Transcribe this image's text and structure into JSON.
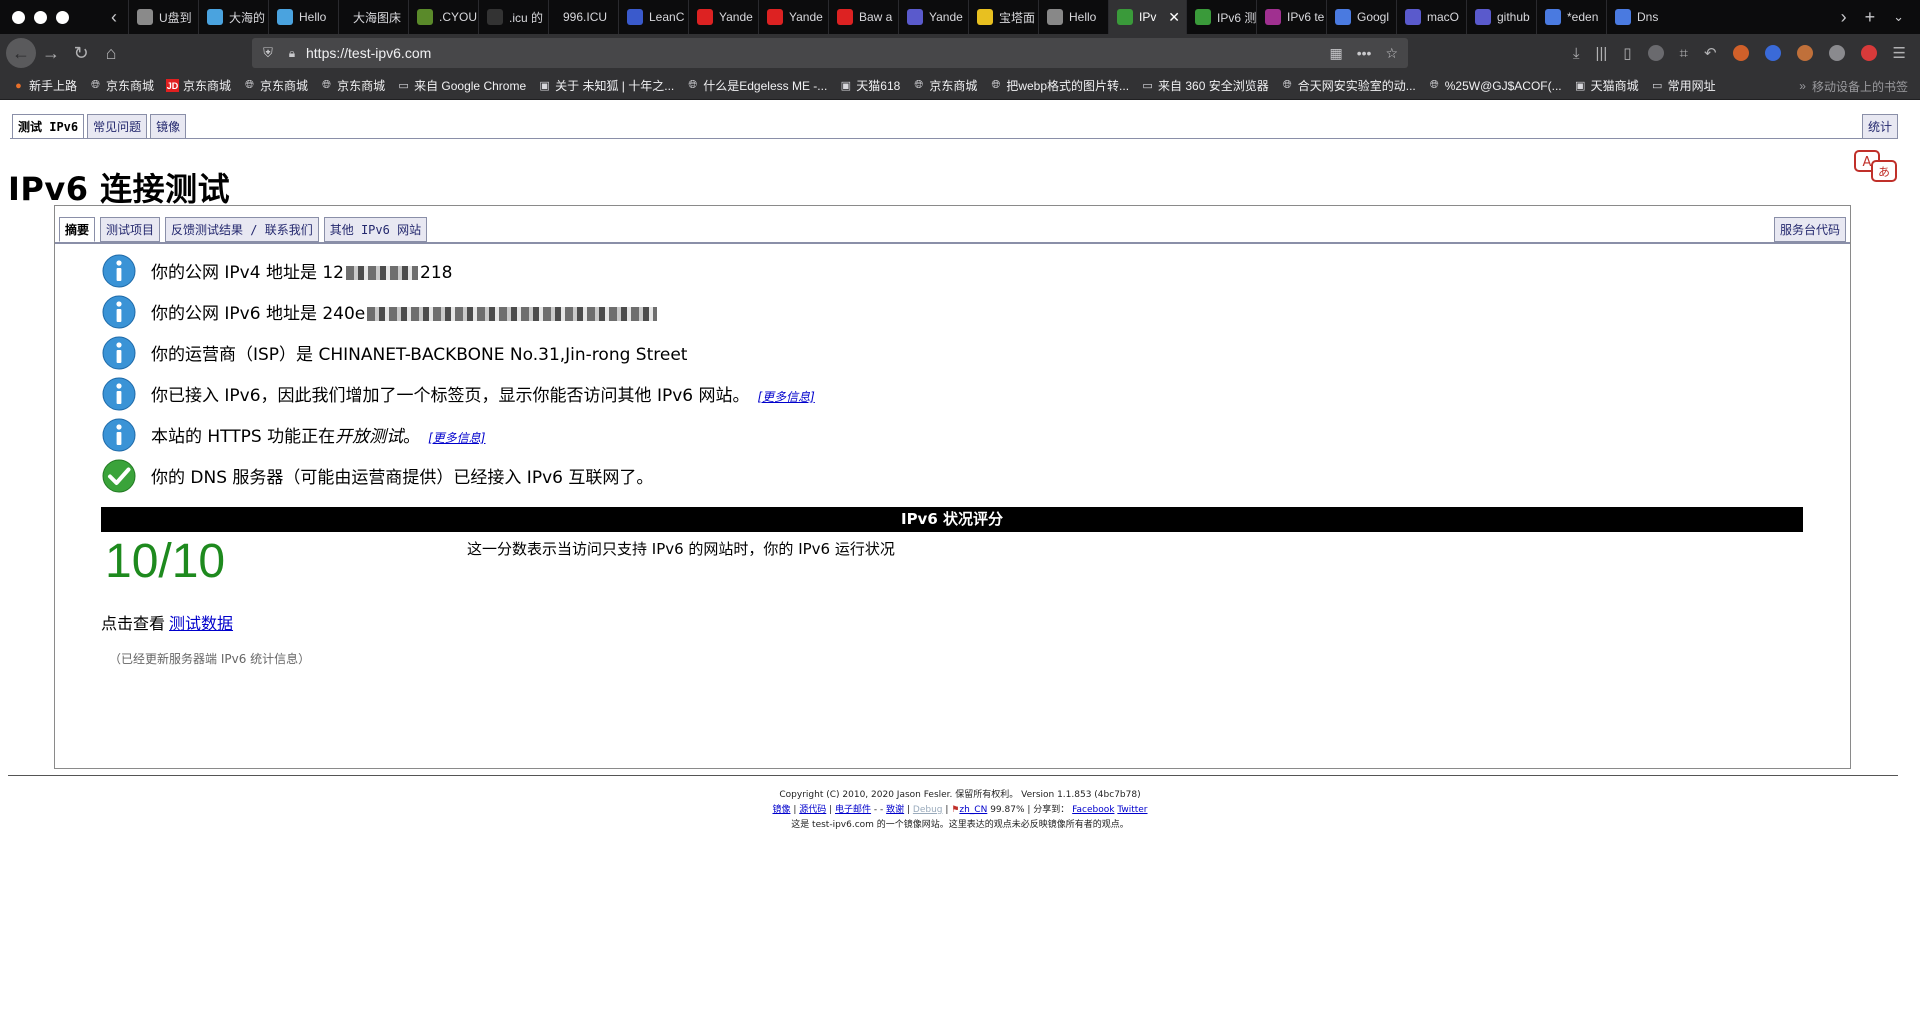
{
  "browser": {
    "tabs": [
      {
        "label": "U盘到",
        "color": "#8a8a8a"
      },
      {
        "label": "大海的",
        "color": "#4aa3df"
      },
      {
        "label": "Hello",
        "color": "#4aa3df"
      },
      {
        "label": "大海图床",
        "color": ""
      },
      {
        "label": ".CYOU",
        "color": "#5a8a2a"
      },
      {
        "label": ".icu 的",
        "color": "#333333"
      },
      {
        "label": "996.ICU",
        "color": ""
      },
      {
        "label": "LeanC",
        "color": "#3a5acc"
      },
      {
        "label": "Yande",
        "color": "#d22"
      },
      {
        "label": "Yande",
        "color": "#d22"
      },
      {
        "label": "Baw a",
        "color": "#d22"
      },
      {
        "label": "Yande",
        "color": "#5a5acc"
      },
      {
        "label": "宝塔面",
        "color": "#e8c020"
      },
      {
        "label": "Hello",
        "color": "#888"
      },
      {
        "label": "IPv",
        "color": "#3a9a3a",
        "active": true
      },
      {
        "label": "IPv6 测",
        "color": "#3a9a3a"
      },
      {
        "label": "IPv6 te",
        "color": "#a03090"
      },
      {
        "label": "Googl",
        "color": "#4a7ae0"
      },
      {
        "label": "macO",
        "color": "#5a5acc"
      },
      {
        "label": "github",
        "color": "#5a5acc"
      },
      {
        "label": "*eden",
        "color": "#4a7ae0"
      },
      {
        "label": "Dns",
        "color": "#4a7ae0"
      }
    ],
    "url": "https://test-ipv6.com",
    "bookmarks": [
      {
        "label": "新手上路",
        "icon": "firefox-icon"
      },
      {
        "label": "京东商城",
        "icon": "globe-icon"
      },
      {
        "label": "京东商城",
        "icon": "jd-icon"
      },
      {
        "label": "京东商城",
        "icon": "globe-icon"
      },
      {
        "label": "京东商城",
        "icon": "globe-icon"
      },
      {
        "label": "来自 Google Chrome",
        "icon": "folder-icon"
      },
      {
        "label": "关于 未知狐 | 十年之...",
        "icon": "image-icon"
      },
      {
        "label": "什么是Edgeless ME -...",
        "icon": "globe-icon"
      },
      {
        "label": "天猫618",
        "icon": "image-icon"
      },
      {
        "label": "京东商城",
        "icon": "globe-icon"
      },
      {
        "label": "把webp格式的图片转...",
        "icon": "globe-icon"
      },
      {
        "label": "来自 360 安全浏览器",
        "icon": "folder-icon"
      },
      {
        "label": "合天网安实验室的动...",
        "icon": "globe-icon"
      },
      {
        "label": "%25W@GJ$ACOF(...",
        "icon": "globe-icon"
      },
      {
        "label": "天猫商城",
        "icon": "image-icon"
      },
      {
        "label": "常用网址",
        "icon": "folder-icon"
      }
    ],
    "mobile_bookmarks": "移动设备上的书签"
  },
  "site": {
    "top_tabs": [
      "测试 IPv6",
      "常见问题",
      "镜像"
    ],
    "stats_tab": "统计",
    "title": "IPv6 连接测试",
    "inner_tabs": [
      "摘要",
      "测试项目",
      "反馈测试结果 / 联系我们",
      "其他 IPv6 网站"
    ],
    "service_tab": "服务台代码",
    "messages": [
      {
        "pre": "你的公网 IPv4 地址是 12",
        "post": "218",
        "icon": "info-icon"
      },
      {
        "pre": "你的公网 IPv6 地址是 240e",
        "post": "",
        "icon": "info-icon"
      },
      {
        "pre": "你的运营商（ISP）是 CHINANET-BACKBONE No.31,Jin-rong Street",
        "post": "",
        "icon": "info-icon"
      },
      {
        "pre": "你已接入 IPv6，因此我们增加了一个标签页，显示你能否访问其他 IPv6 网站。",
        "more": "[更多信息]",
        "icon": "info-icon"
      },
      {
        "pre": "本站的 HTTPS 功能正在",
        "em": "开放测试",
        "post": "。",
        "more": "[更多信息]",
        "icon": "info-icon"
      },
      {
        "pre": "你的 DNS 服务器（可能由运营商提供）已经接入 IPv6 互联网了。",
        "icon": "check-icon"
      }
    ],
    "score_header": "IPv6 状况评分",
    "score": "10/10",
    "score_desc": "这一分数表示当访问只支持 IPv6 的网站时，你的 IPv6 运行状况",
    "data_prefix": "点击查看",
    "data_link": "测试数据",
    "updated": "（已经更新服务器端 IPv6 统计信息）",
    "footer": {
      "copyright": "Copyright (C) 2010, 2020 Jason Fesler. 保留所有权利。 Version 1.1.853 (4bc7b78)",
      "links": [
        "镜像",
        "源代码",
        "电子邮件",
        "致谢",
        "Debug",
        "zh_CN"
      ],
      "percent": "99.87%",
      "share": "分享到：",
      "share_links": [
        "Facebook",
        "Twitter"
      ],
      "mirror_note": "这是 test-ipv6.com 的一个镜像网站。这里表达的观点未必反映镜像所有者的观点。"
    },
    "colors": {
      "score_green": "#1e8a1e",
      "info_blue": "#3a93d6",
      "check_green": "#3aa33a",
      "link_blue": "#0000cc"
    }
  }
}
